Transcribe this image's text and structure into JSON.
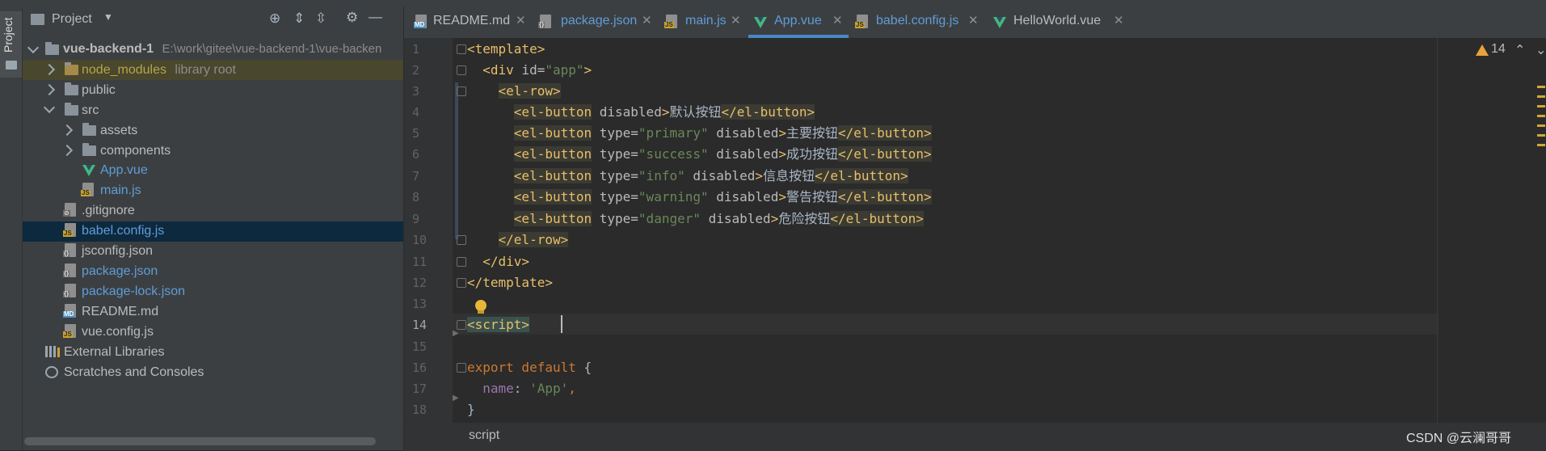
{
  "sidebar_stripe": {
    "label": "Project"
  },
  "project_panel": {
    "title": "Project",
    "tree": [
      {
        "label": "vue-backend-1",
        "hint": "E:\\work\\gitee\\vue-backend-1\\vue-backen"
      },
      {
        "label": "node_modules",
        "hint": "library root"
      },
      {
        "label": "public"
      },
      {
        "label": "src"
      },
      {
        "label": "assets"
      },
      {
        "label": "components"
      },
      {
        "label": "App.vue"
      },
      {
        "label": "main.js"
      },
      {
        "label": ".gitignore"
      },
      {
        "label": "babel.config.js"
      },
      {
        "label": "jsconfig.json"
      },
      {
        "label": "package.json"
      },
      {
        "label": "package-lock.json"
      },
      {
        "label": "README.md"
      },
      {
        "label": "vue.config.js"
      },
      {
        "label": "External Libraries"
      },
      {
        "label": "Scratches and Consoles"
      }
    ]
  },
  "tabs": [
    {
      "label": "README.md"
    },
    {
      "label": "package.json"
    },
    {
      "label": "main.js"
    },
    {
      "label": "App.vue"
    },
    {
      "label": "babel.config.js"
    },
    {
      "label": "HelloWorld.vue"
    }
  ],
  "editor": {
    "line_numbers": [
      "1",
      "2",
      "3",
      "4",
      "5",
      "6",
      "7",
      "8",
      "9",
      "10",
      "11",
      "12",
      "13",
      "14",
      "15",
      "16",
      "17",
      "18"
    ],
    "lines": {
      "l1": {
        "open": "<template>"
      },
      "l2": {
        "t1": "<div ",
        "a1": "id=",
        "s1": "\"app\"",
        "t2": ">"
      },
      "l3": {
        "t1": "<el-row>"
      },
      "l4": {
        "t1": "<el-button",
        "a1": " disabled",
        "t2": ">",
        "text": "默认按钮",
        "t3": "</el-button>"
      },
      "l5": {
        "t1": "<el-button",
        "a1": " type=",
        "s1": "\"primary\"",
        "a2": " disabled",
        "t2": ">",
        "text": "主要按钮",
        "t3": "</el-button>"
      },
      "l6": {
        "t1": "<el-button",
        "a1": " type=",
        "s1": "\"success\"",
        "a2": " disabled",
        "t2": ">",
        "text": "成功按钮",
        "t3": "</el-button>"
      },
      "l7": {
        "t1": "<el-button",
        "a1": " type=",
        "s1": "\"info\"",
        "a2": " disabled",
        "t2": ">",
        "text": "信息按钮",
        "t3": "</el-button>"
      },
      "l8": {
        "t1": "<el-button",
        "a1": " type=",
        "s1": "\"warning\"",
        "a2": " disabled",
        "t2": ">",
        "text": "警告按钮",
        "t3": "</el-button>"
      },
      "l9": {
        "t1": "<el-button",
        "a1": " type=",
        "s1": "\"danger\"",
        "a2": " disabled",
        "t2": ">",
        "text": "危险按钮",
        "t3": "</el-button>"
      },
      "l10": {
        "t1": "</el-row>"
      },
      "l11": {
        "t1": "</div>"
      },
      "l12": {
        "t1": "</template>"
      },
      "l14": {
        "t1": "<script>"
      },
      "l16": {
        "kw1": "export",
        "kw2": " default",
        "rest": " {"
      },
      "l17": {
        "nm": "name",
        "rest": ": ",
        "s1": "'App'",
        "rest2": ","
      },
      "l18": {
        "rest": "}"
      }
    }
  },
  "inspections": {
    "warning_count": "14"
  },
  "breadcrumb": {
    "text": "script"
  },
  "watermark": {
    "text": "CSDN @云澜哥哥"
  },
  "colors": {
    "tag": "#e8bf6a",
    "attr_value": "#6a8759",
    "keyword": "#cc7832",
    "property": "#9876aa",
    "selection": "#0d293e",
    "accent": "#4a88c7"
  }
}
